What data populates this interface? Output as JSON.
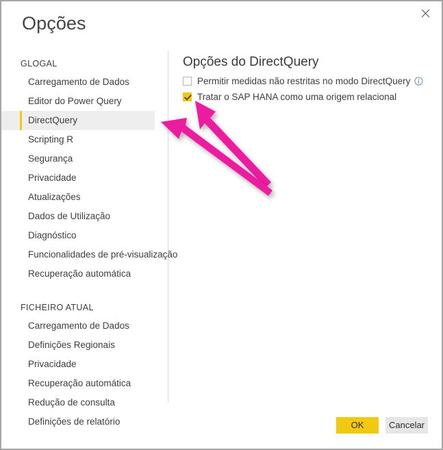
{
  "window": {
    "title": "Opções",
    "close_icon": "close-icon"
  },
  "sidebar": {
    "groups": [
      {
        "heading": "GLOGAL",
        "items": [
          {
            "label": "Carregamento de Dados",
            "selected": false
          },
          {
            "label": "Editor do Power Query",
            "selected": false
          },
          {
            "label": "DirectQuery",
            "selected": true
          },
          {
            "label": "Scripting R",
            "selected": false
          },
          {
            "label": "Segurança",
            "selected": false
          },
          {
            "label": "Privacidade",
            "selected": false
          },
          {
            "label": "Atualizações",
            "selected": false
          },
          {
            "label": "Dados de Utilização",
            "selected": false
          },
          {
            "label": "Diagnóstico",
            "selected": false
          },
          {
            "label": "Funcionalidades de pré-visualização",
            "selected": false
          },
          {
            "label": "Recuperação automática",
            "selected": false
          }
        ]
      },
      {
        "heading": "FICHEIRO ATUAL",
        "items": [
          {
            "label": "Carregamento de Dados",
            "selected": false
          },
          {
            "label": "Definições Regionais",
            "selected": false
          },
          {
            "label": "Privacidade",
            "selected": false
          },
          {
            "label": "Recuperação automática",
            "selected": false
          },
          {
            "label": "Redução de consulta",
            "selected": false
          },
          {
            "label": "Definições de relatório",
            "selected": false
          }
        ]
      }
    ]
  },
  "content": {
    "title": "Opções do DirectQuery",
    "options": [
      {
        "label": "Permitir medidas não restritas no modo DirectQuery",
        "checked": false,
        "has_info_icon": true,
        "info_icon": "info-circle-icon"
      },
      {
        "label": "Tratar o SAP HANA como uma origem relacional",
        "checked": true,
        "has_info_icon": false,
        "info_icon": ""
      }
    ]
  },
  "footer": {
    "ok_label": "OK",
    "cancel_label": "Cancelar"
  },
  "colors": {
    "accent_yellow": "#f2c811",
    "annotation_pink": "#ec1ba0",
    "selected_row": "#eeeeee",
    "window_border": "#a6a6a6",
    "text": "#3d3d3d"
  },
  "annotations": {
    "arrows": [
      {
        "name": "arrow-to-checkbox",
        "target": "Tratar o SAP HANA como uma origem relacional"
      },
      {
        "name": "arrow-to-directquery-nav",
        "target": "DirectQuery"
      }
    ]
  }
}
